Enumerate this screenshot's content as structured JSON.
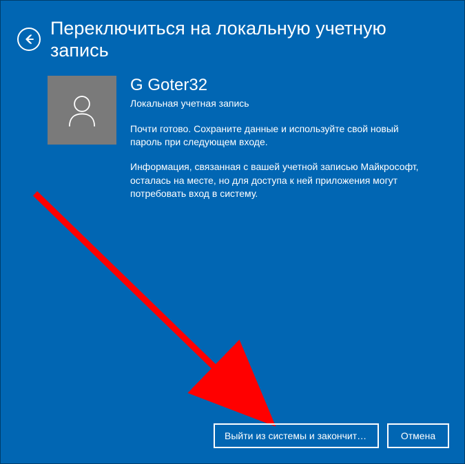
{
  "header": {
    "title": "Переключиться на локальную учетную запись"
  },
  "user": {
    "name": "G Goter32",
    "account_type": "Локальная учетная запись"
  },
  "body": {
    "paragraph1": "Почти готово. Сохраните данные и используйте свой новый пароль при следующем входе.",
    "paragraph2": "Информация, связанная с вашей учетной записью Майкрософт, осталась на месте, но для доступа к ней приложения могут потребовать вход в систему."
  },
  "footer": {
    "primary_label": "Выйти из системы и закончить р...",
    "cancel_label": "Отмена"
  },
  "colors": {
    "background": "#0166b3",
    "avatar_bg": "#7a7a7a",
    "text": "#ffffff",
    "arrow": "#ff0000"
  }
}
